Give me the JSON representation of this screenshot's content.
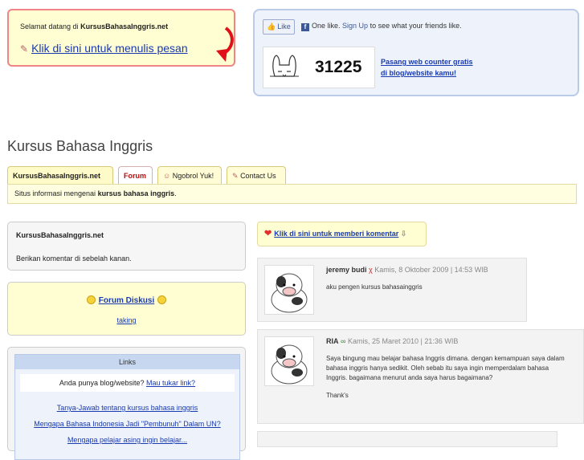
{
  "welcome": {
    "greeting": "Selamat datang di",
    "site": "KursusBahasaInggris.net",
    "write_link": "Klik di sini untuk menulis pesan"
  },
  "social": {
    "like_label": "Like",
    "like_text": "One like.",
    "signup": "Sign Up",
    "see_text": "to see what your friends like.",
    "counter_value": "31225",
    "counter_link_line1": "Pasang web counter gratis",
    "counter_link_line2": "di blog/website kamu!"
  },
  "site_title": "Kursus Bahasa Inggris",
  "tabs": [
    {
      "label": "KursusBahasaInggris.net"
    },
    {
      "label": "Forum"
    },
    {
      "label": "Ngobrol Yuk!"
    },
    {
      "label": "Contact Us"
    }
  ],
  "info": {
    "prefix": "Situs informasi mengenai",
    "bold": "kursus bahasa inggris",
    "suffix": "."
  },
  "sidebar": {
    "box_title": "KursusBahasaInggris.net",
    "box_desc": "Berikan komentar di sebelah kanan.",
    "forum_link": "Forum Diskusi",
    "forum_sub": "taking",
    "links_header": "Links",
    "links_ask": "Anda punya blog/website?",
    "links_ask_link": "Mau tukar link?",
    "links": [
      "Tanya-Jawab tentang kursus bahasa inggris",
      "Mengapa Bahasa Indonesia Jadi \"Pembunuh\" Dalam UN?",
      "Mengapa pelajar asing ingin belajar..."
    ]
  },
  "comments_cta": "Klik di sini untuk memberi komentar",
  "comments": [
    {
      "author": "jeremy budi",
      "date": "Kamis, 8 Oktober 2009 | 14:53 WIB",
      "text": "aku pengen kursus bahasainggris"
    },
    {
      "author": "RIA",
      "date": "Kamis, 25 Maret 2010 | 21:36 WIB",
      "text": "Saya bingung mau belajar bahasa Inggris dimana. dengan kemampuan saya dalam bahasa inggris hanya sedikit. Oleh sebab itu saya ingin memperdalam bahasa Inggris. bagaimana menurut anda saya harus bagaimana?",
      "thanks": "Thank's"
    }
  ]
}
